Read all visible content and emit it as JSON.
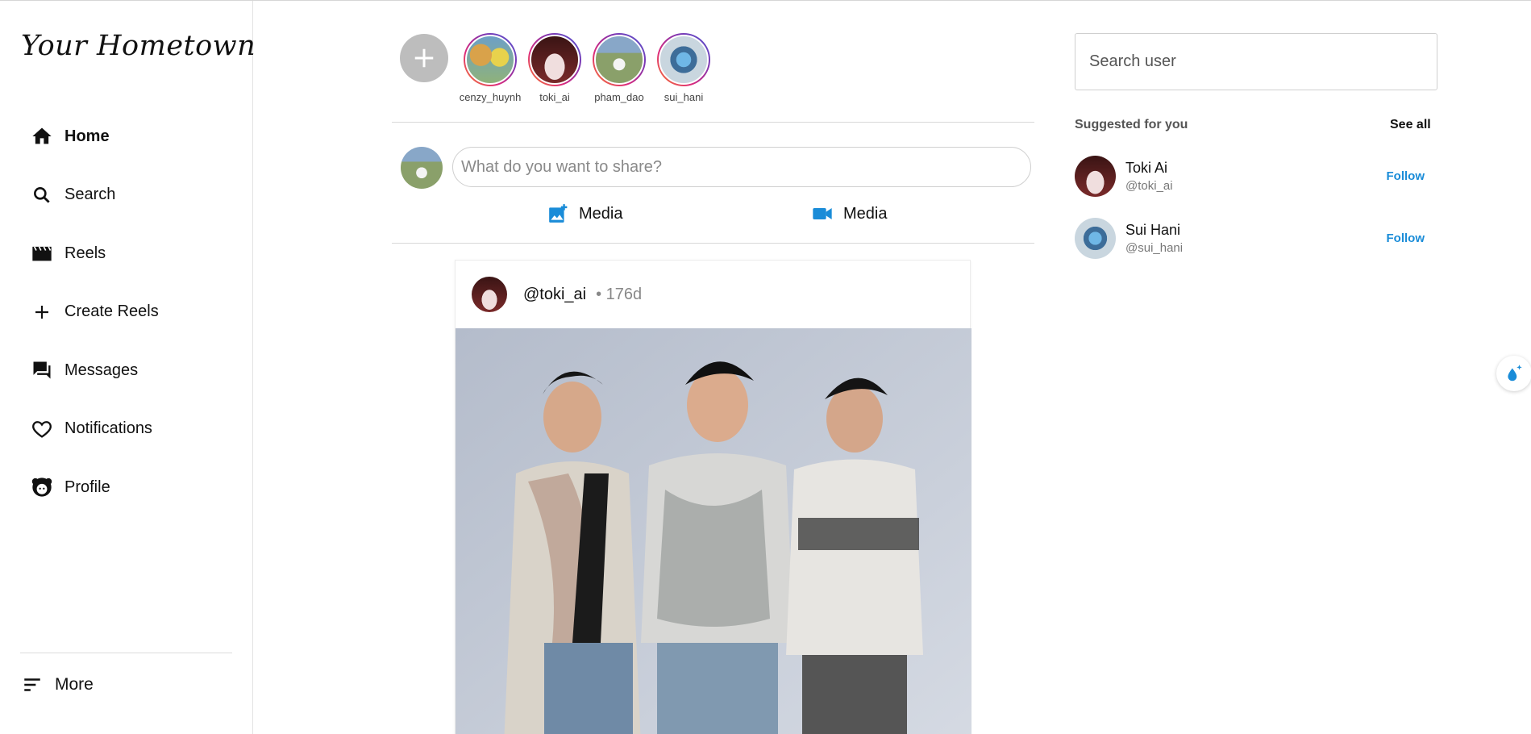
{
  "app": {
    "logo": "Your Hometown"
  },
  "sidebar": {
    "items": [
      {
        "label": "Home",
        "icon": "home-icon",
        "active": true
      },
      {
        "label": "Search",
        "icon": "search-icon"
      },
      {
        "label": "Reels",
        "icon": "clapperboard-icon"
      },
      {
        "label": "Create Reels",
        "icon": "plus-icon"
      },
      {
        "label": "Messages",
        "icon": "chat-bubbles-icon"
      },
      {
        "label": "Notifications",
        "icon": "heart-icon"
      },
      {
        "label": "Profile",
        "icon": "profile-face-icon"
      }
    ],
    "more": "More"
  },
  "stories": [
    {
      "name": "cenzy_huynh"
    },
    {
      "name": "toki_ai"
    },
    {
      "name": "pham_dao"
    },
    {
      "name": "sui_hani"
    }
  ],
  "composer": {
    "placeholder": "What do you want to share?",
    "photo_label": "Media",
    "video_label": "Media"
  },
  "post": {
    "user": "@toki_ai",
    "time": "• 176d"
  },
  "right": {
    "search_placeholder": "Search user",
    "suggested_title": "Suggested for you",
    "see_all": "See all",
    "suggestions": [
      {
        "name": "Toki Ai",
        "handle": "@toki_ai",
        "action": "Follow"
      },
      {
        "name": "Sui Hani",
        "handle": "@sui_hani",
        "action": "Follow"
      }
    ]
  },
  "colors": {
    "accent": "#1a8cd8",
    "story_add": "#bdbdbd"
  }
}
